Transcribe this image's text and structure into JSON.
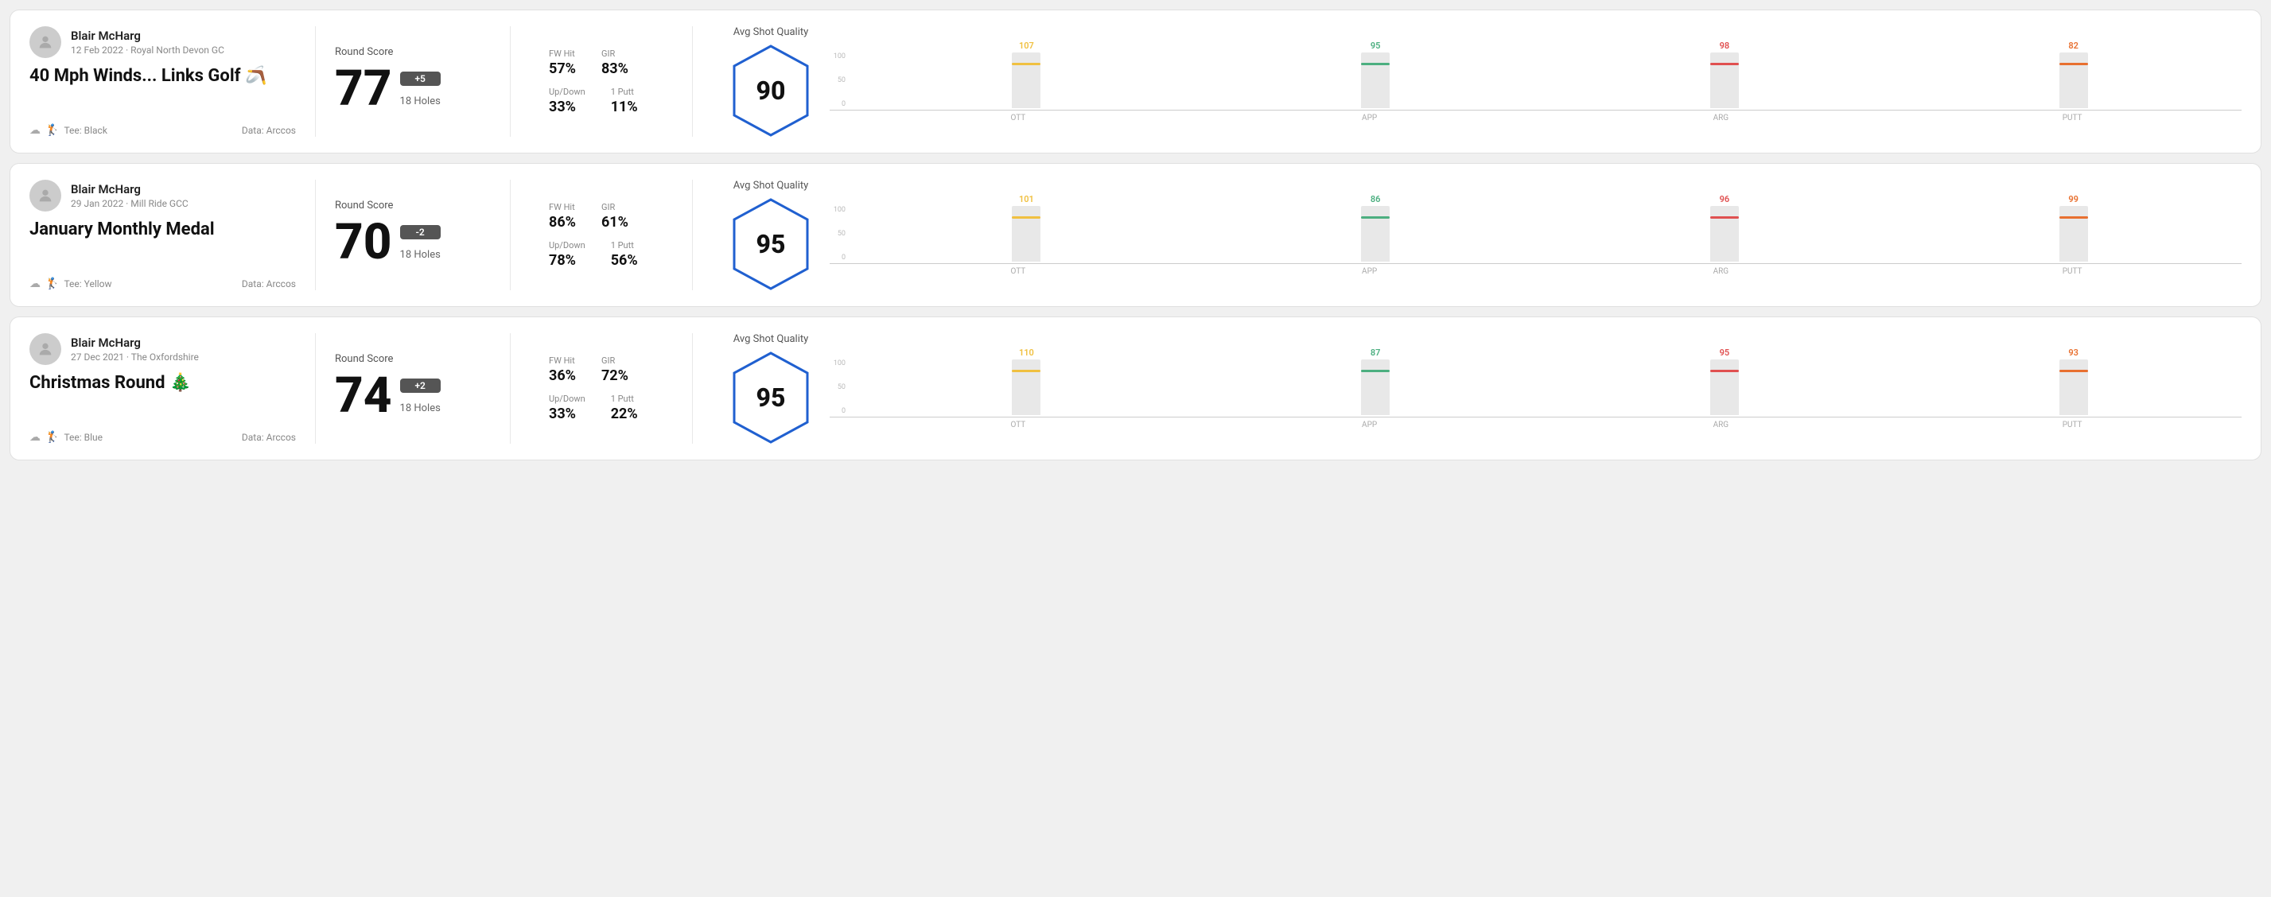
{
  "rounds": [
    {
      "id": "round-1",
      "player": {
        "name": "Blair McHarg",
        "date": "12 Feb 2022 · Royal North Devon GC"
      },
      "title": "40 Mph Winds... Links Golf",
      "title_emoji": "🪃",
      "tee": "Black",
      "data_source": "Data: Arccos",
      "round_score": {
        "label": "Round Score",
        "score": "77",
        "badge": "+5",
        "holes": "18 Holes"
      },
      "stats": {
        "fw_hit_label": "FW Hit",
        "fw_hit_value": "57%",
        "gir_label": "GIR",
        "gir_value": "83%",
        "updown_label": "Up/Down",
        "updown_value": "33%",
        "one_putt_label": "1 Putt",
        "one_putt_value": "11%"
      },
      "shot_quality": {
        "label": "Avg Shot Quality",
        "score": "90",
        "bars": [
          {
            "category": "OTT",
            "value": 107,
            "color": "#f0c040",
            "max": 130
          },
          {
            "category": "APP",
            "value": 95,
            "color": "#4caf80",
            "max": 130
          },
          {
            "category": "ARG",
            "value": 98,
            "color": "#e05050",
            "max": 130
          },
          {
            "category": "PUTT",
            "value": 82,
            "color": "#e87030",
            "max": 130
          }
        ]
      }
    },
    {
      "id": "round-2",
      "player": {
        "name": "Blair McHarg",
        "date": "29 Jan 2022 · Mill Ride GCC"
      },
      "title": "January Monthly Medal",
      "title_emoji": "",
      "tee": "Yellow",
      "data_source": "Data: Arccos",
      "round_score": {
        "label": "Round Score",
        "score": "70",
        "badge": "-2",
        "holes": "18 Holes"
      },
      "stats": {
        "fw_hit_label": "FW Hit",
        "fw_hit_value": "86%",
        "gir_label": "GIR",
        "gir_value": "61%",
        "updown_label": "Up/Down",
        "updown_value": "78%",
        "one_putt_label": "1 Putt",
        "one_putt_value": "56%"
      },
      "shot_quality": {
        "label": "Avg Shot Quality",
        "score": "95",
        "bars": [
          {
            "category": "OTT",
            "value": 101,
            "color": "#f0c040",
            "max": 130
          },
          {
            "category": "APP",
            "value": 86,
            "color": "#4caf80",
            "max": 130
          },
          {
            "category": "ARG",
            "value": 96,
            "color": "#e05050",
            "max": 130
          },
          {
            "category": "PUTT",
            "value": 99,
            "color": "#e87030",
            "max": 130
          }
        ]
      }
    },
    {
      "id": "round-3",
      "player": {
        "name": "Blair McHarg",
        "date": "27 Dec 2021 · The Oxfordshire"
      },
      "title": "Christmas Round",
      "title_emoji": "🎄",
      "tee": "Blue",
      "data_source": "Data: Arccos",
      "round_score": {
        "label": "Round Score",
        "score": "74",
        "badge": "+2",
        "holes": "18 Holes"
      },
      "stats": {
        "fw_hit_label": "FW Hit",
        "fw_hit_value": "36%",
        "gir_label": "GIR",
        "gir_value": "72%",
        "updown_label": "Up/Down",
        "updown_value": "33%",
        "one_putt_label": "1 Putt",
        "one_putt_value": "22%"
      },
      "shot_quality": {
        "label": "Avg Shot Quality",
        "score": "95",
        "bars": [
          {
            "category": "OTT",
            "value": 110,
            "color": "#f0c040",
            "max": 130
          },
          {
            "category": "APP",
            "value": 87,
            "color": "#4caf80",
            "max": 130
          },
          {
            "category": "ARG",
            "value": 95,
            "color": "#e05050",
            "max": 130
          },
          {
            "category": "PUTT",
            "value": 93,
            "color": "#e87030",
            "max": 130
          }
        ]
      }
    }
  ],
  "y_axis": [
    "100",
    "50",
    "0"
  ]
}
